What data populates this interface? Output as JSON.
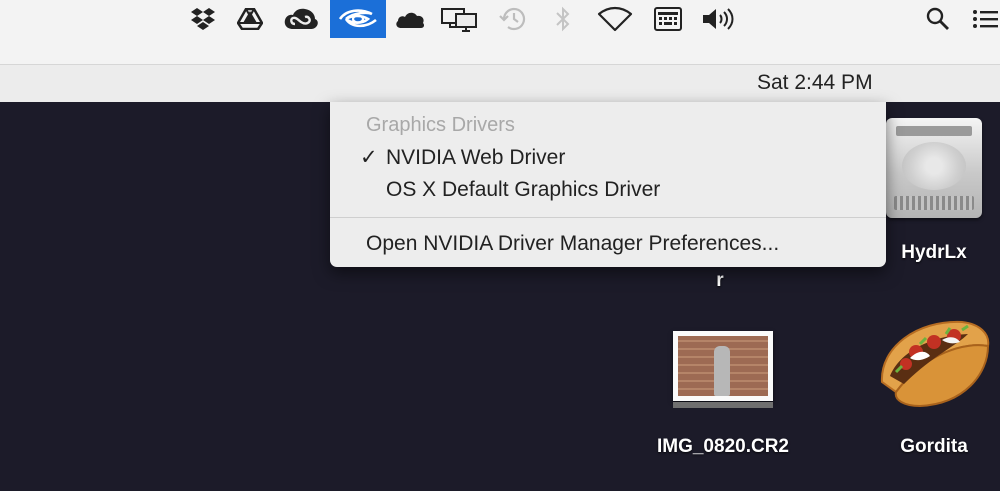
{
  "menubar": {
    "clock": "Sat 2:44 PM",
    "icons": [
      "dropbox-icon",
      "google-drive-icon",
      "creative-cloud-icon",
      "nvidia-icon",
      "cloud-icon",
      "displays-icon",
      "time-machine-icon",
      "bluetooth-icon",
      "wifi-icon",
      "keyboard-icon",
      "volume-icon",
      "spotlight-icon",
      "notification-center-icon"
    ],
    "active_color": "#1b6fd8"
  },
  "dropdown": {
    "header": "Graphics Drivers",
    "items": [
      {
        "check": "✓",
        "label": "NVIDIA Web Driver",
        "selected": true
      },
      {
        "check": "",
        "label": "OS X Default Graphics Driver",
        "selected": false
      }
    ],
    "preferences": "Open NVIDIA Driver Manager Preferences..."
  },
  "desktop": {
    "background_color": "#1c1b29",
    "items": [
      {
        "label": "HydrLx",
        "type": "drive"
      },
      {
        "label": "r",
        "type": "truncated"
      },
      {
        "label": "IMG_0820.CR2",
        "type": "image"
      },
      {
        "label": "Gordita",
        "type": "image"
      }
    ]
  }
}
